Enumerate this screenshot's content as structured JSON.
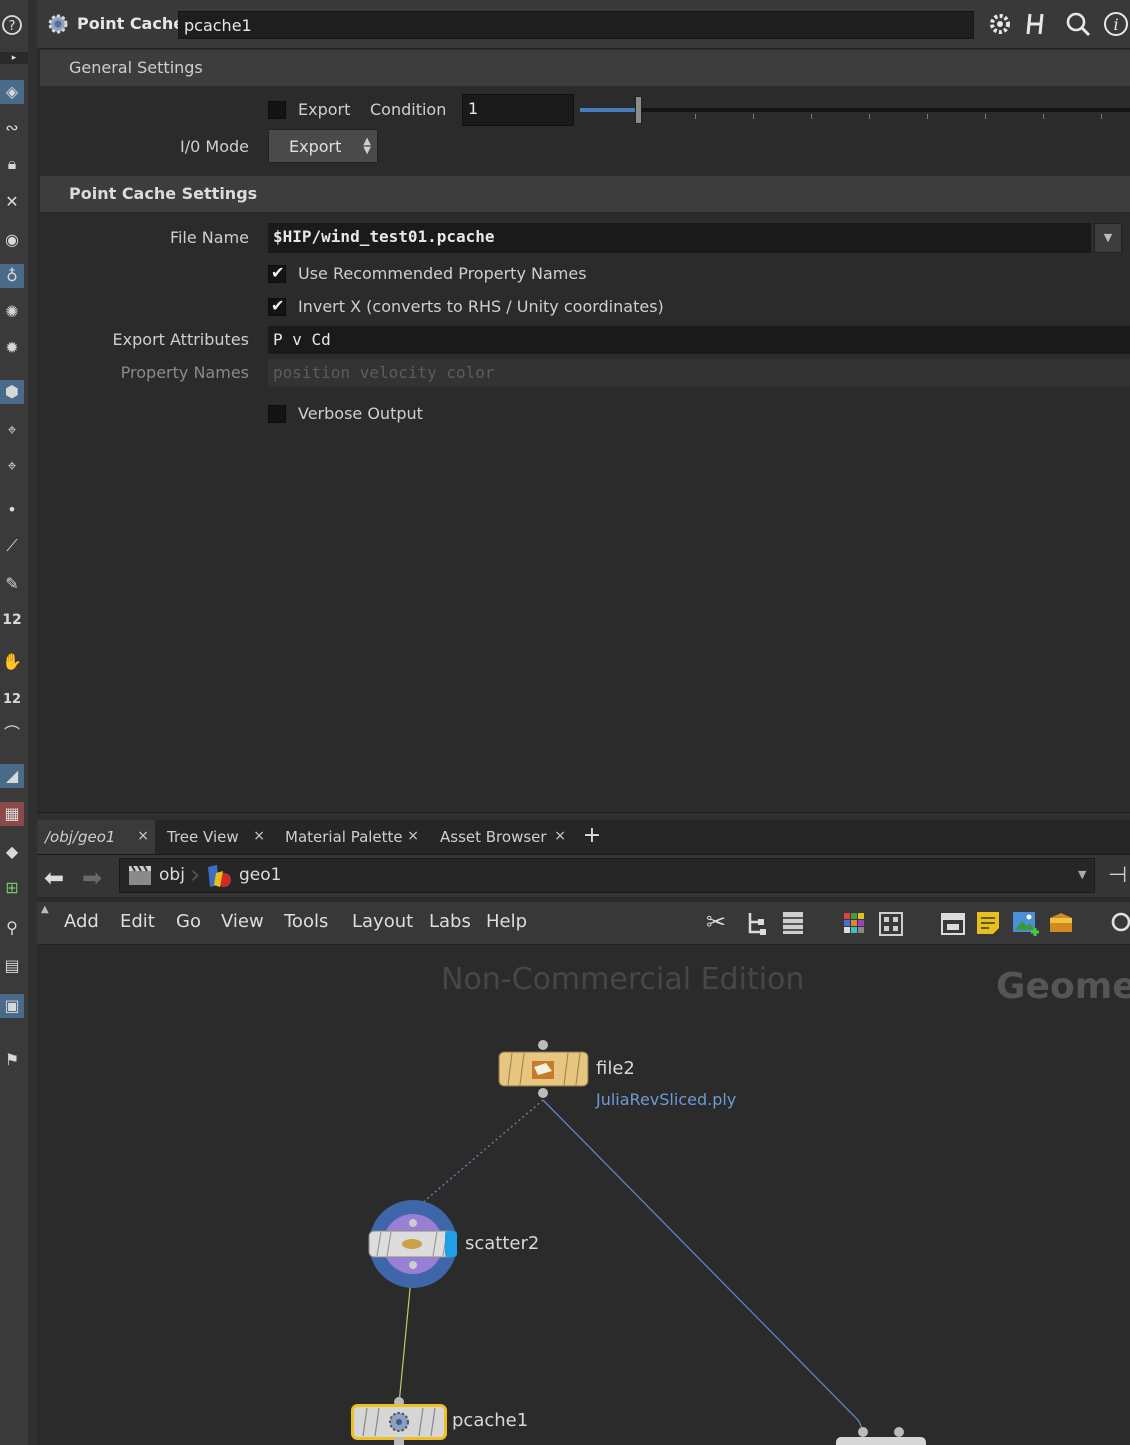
{
  "header": {
    "node_type": "Point Cache",
    "node_name": "pcache1",
    "icons": [
      "gear-icon",
      "houdini-h-icon",
      "search-icon",
      "info-icon"
    ]
  },
  "general_settings": {
    "title": "General Settings",
    "export_label": "Export",
    "export_checked": false,
    "condition_label": "Condition",
    "condition_value": "1",
    "io_mode_label": "I/0 Mode",
    "io_mode_value": "Export"
  },
  "point_cache_settings": {
    "title": "Point Cache Settings",
    "file_name_label": "File Name",
    "file_name_value": "$HIP/wind_test01.pcache",
    "use_recommended_label": "Use Recommended Property Names",
    "use_recommended_checked": true,
    "invert_x_label": "Invert X (converts to RHS / Unity coordinates)",
    "invert_x_checked": true,
    "export_attributes_label": "Export Attributes",
    "export_attributes_value": "P  v  Cd",
    "property_names_label": "Property Names",
    "property_names_placeholder": "position velocity color",
    "verbose_label": "Verbose Output",
    "verbose_checked": false
  },
  "tabs": [
    {
      "label": "/obj/geo1"
    },
    {
      "label": "Tree View"
    },
    {
      "label": "Material Palette"
    },
    {
      "label": "Asset Browser"
    }
  ],
  "path": {
    "segments": [
      "obj",
      "geo1"
    ]
  },
  "menu": [
    "Add",
    "Edit",
    "Go",
    "View",
    "Tools",
    "Layout",
    "Labs",
    "Help"
  ],
  "network": {
    "watermark": "Non-Commercial Edition",
    "context_label": "Geomet",
    "nodes": {
      "file2": {
        "name": "file2",
        "subtitle": "JuliaRevSliced.ply"
      },
      "scatter2": {
        "name": "scatter2"
      },
      "pcache1": {
        "name": "pcache1"
      }
    }
  },
  "colors": {
    "accent_blue": "#4a7dbb",
    "node_selected_outline": "#f0c020",
    "file_node": "#e6c681",
    "scatter_ring": "#3f66a8",
    "scatter_inner": "#9a7fd6"
  }
}
